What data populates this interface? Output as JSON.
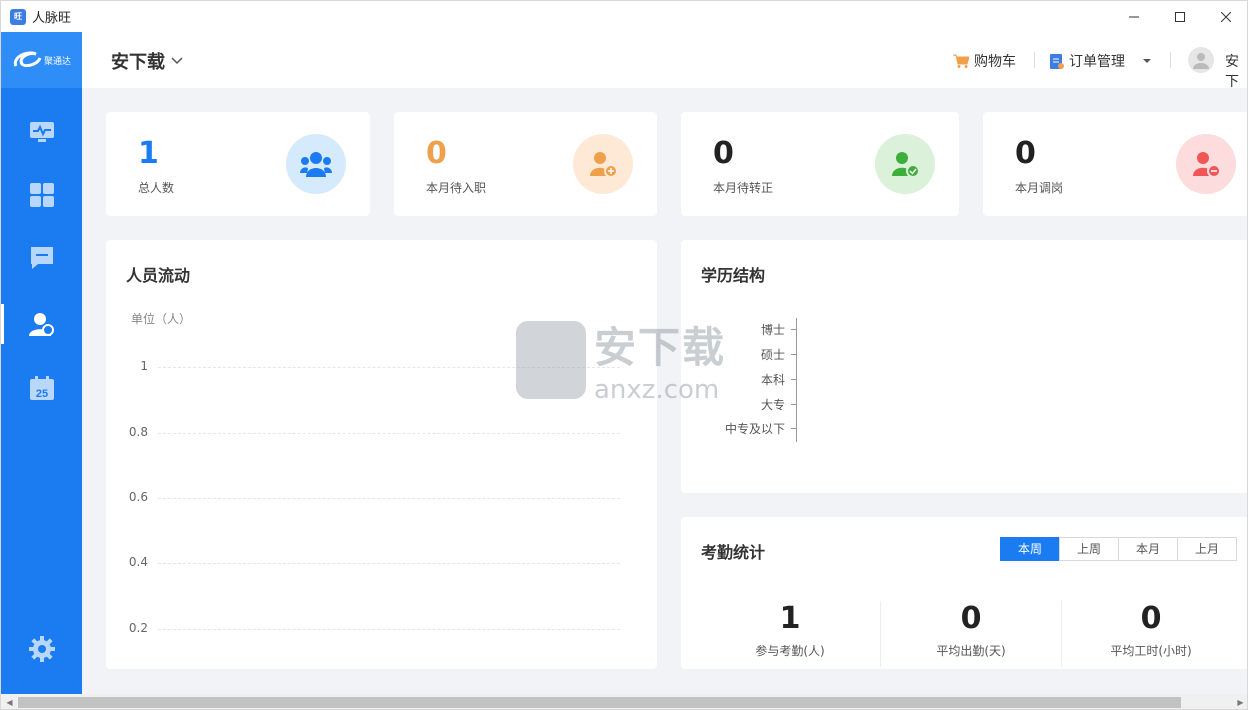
{
  "window": {
    "title": "人脉旺",
    "app_icon_text": "旺"
  },
  "sidebar": {
    "logo_text": "聚通达",
    "items": [
      {
        "name": "dashboard",
        "active": false
      },
      {
        "name": "apps",
        "active": false
      },
      {
        "name": "messages",
        "active": false
      },
      {
        "name": "people",
        "active": true
      },
      {
        "name": "calendar",
        "active": false,
        "badge": "25"
      },
      {
        "name": "settings",
        "active": false
      }
    ]
  },
  "header": {
    "company": "安下载",
    "cart": "购物车",
    "orders": "订单管理",
    "user": "安下"
  },
  "stats": [
    {
      "value": "1",
      "label": "总人数",
      "value_color": "#1a7cf0",
      "circle_color": "#d6eafd",
      "icon_color": "#1a7cf0"
    },
    {
      "value": "0",
      "label": "本月待入职",
      "value_color": "#f0a04b",
      "circle_color": "#fde9d6",
      "icon_color": "#f0a04b"
    },
    {
      "value": "0",
      "label": "本月待转正",
      "value_color": "#222222",
      "circle_color": "#dcf1d9",
      "icon_color": "#3eae3a"
    },
    {
      "value": "0",
      "label": "本月调岗",
      "value_color": "#222222",
      "circle_color": "#fcdcdc",
      "icon_color": "#f05656"
    }
  ],
  "flow_panel": {
    "title": "人员流动",
    "unit": "单位（人）",
    "yticks": [
      "1",
      "0.8",
      "0.6",
      "0.4",
      "0.2"
    ]
  },
  "edu_panel": {
    "title": "学历结构",
    "categories": [
      "博士",
      "硕士",
      "本科",
      "大专",
      "中专及以下"
    ]
  },
  "attendance": {
    "title": "考勤统计",
    "tabs": [
      "本周",
      "上周",
      "本月",
      "上月"
    ],
    "active_tab": 0,
    "metrics": [
      {
        "value": "1",
        "label": "参与考勤(人)"
      },
      {
        "value": "0",
        "label": "平均出勤(天)"
      },
      {
        "value": "0",
        "label": "平均工时(小时)"
      }
    ]
  },
  "watermark": {
    "text1": "安下载",
    "text2": "anxz.com"
  }
}
